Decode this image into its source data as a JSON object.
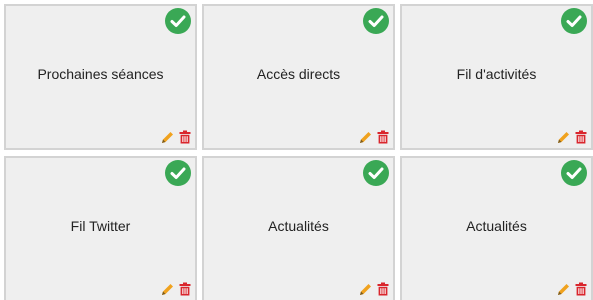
{
  "colors": {
    "check": "#3aa855",
    "edit": "#f0a21e",
    "delete": "#d9262d"
  },
  "widgets": [
    {
      "title": "Prochaines séances",
      "status_icon": "check-icon",
      "actions": [
        "pencil-icon",
        "trash-icon"
      ]
    },
    {
      "title": "Accès directs",
      "status_icon": "check-icon",
      "actions": [
        "pencil-icon",
        "trash-icon"
      ]
    },
    {
      "title": "Fil d'activités",
      "status_icon": "check-icon",
      "actions": [
        "pencil-icon",
        "trash-icon"
      ]
    },
    {
      "title": "Fil Twitter",
      "status_icon": "check-icon",
      "actions": [
        "pencil-icon",
        "trash-icon"
      ]
    },
    {
      "title": "Actualités",
      "status_icon": "check-icon",
      "actions": [
        "pencil-icon",
        "trash-icon"
      ]
    },
    {
      "title": "Actualités",
      "status_icon": "check-icon",
      "actions": [
        "pencil-icon",
        "trash-icon"
      ]
    }
  ]
}
